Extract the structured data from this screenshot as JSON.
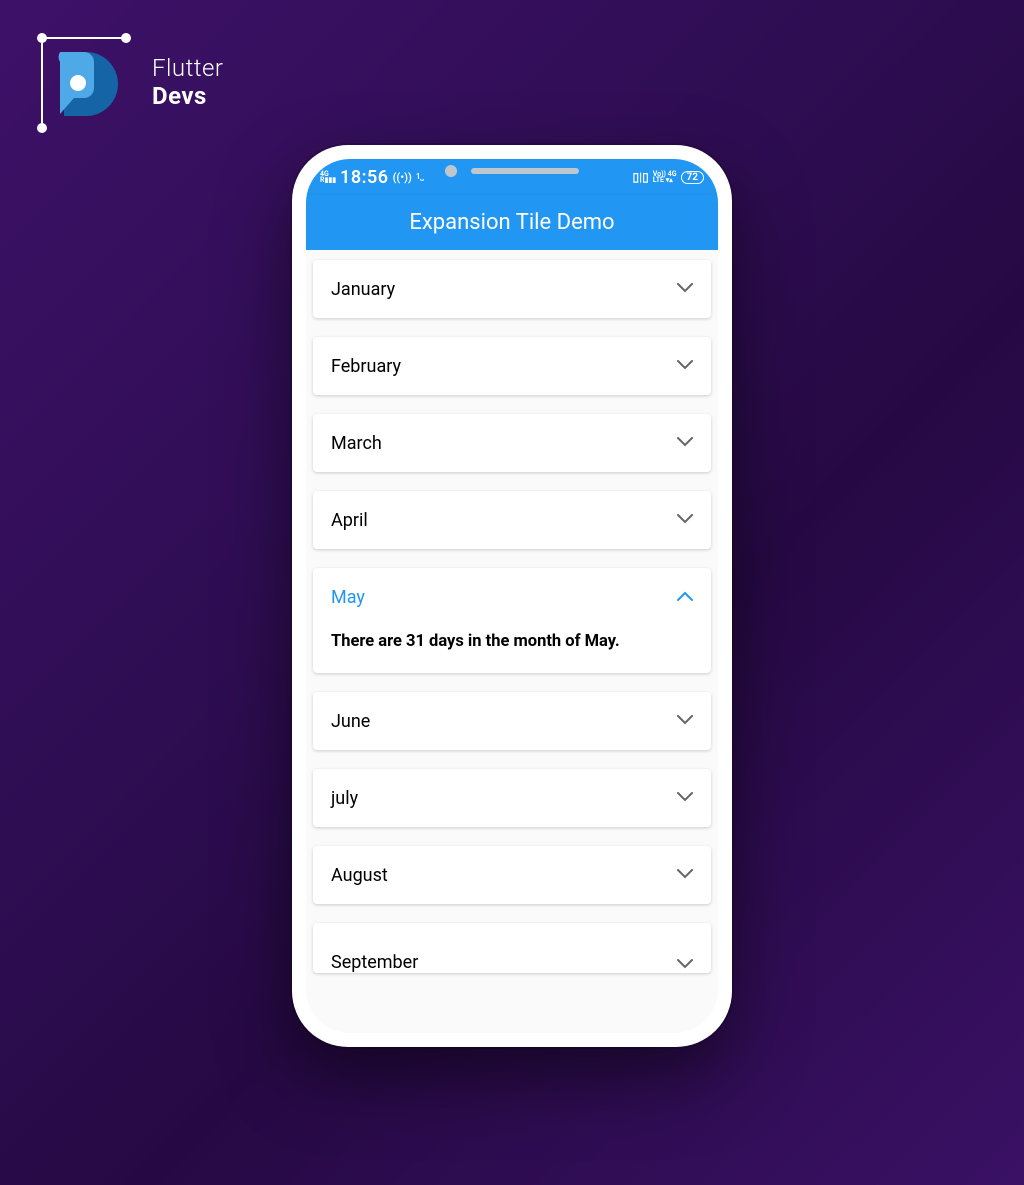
{
  "logo": {
    "line1": "Flutter",
    "line2": "Devs"
  },
  "status": {
    "network": "4G",
    "signal": "R▮▮▮",
    "time": "18:56",
    "wifi": "((•))",
    "vib": "⟳",
    "lte1": "Vo))  4G",
    "lte2": "LTE  ▾▴",
    "battery": "72"
  },
  "appBar": {
    "title": "Expansion Tile Demo"
  },
  "tiles": [
    {
      "label": "January",
      "expanded": false
    },
    {
      "label": "February",
      "expanded": false
    },
    {
      "label": "March",
      "expanded": false
    },
    {
      "label": "April",
      "expanded": false
    },
    {
      "label": "May",
      "expanded": true,
      "content": "There are 31 days in the month of May."
    },
    {
      "label": "June",
      "expanded": false
    },
    {
      "label": "july",
      "expanded": false
    },
    {
      "label": "August",
      "expanded": false
    },
    {
      "label": "September",
      "expanded": false
    }
  ],
  "colors": {
    "accent": "#2196f3",
    "bgPurple": "#2e0d52",
    "logoBlue1": "#4fa9e6",
    "logoBlue2": "#1565a6"
  }
}
